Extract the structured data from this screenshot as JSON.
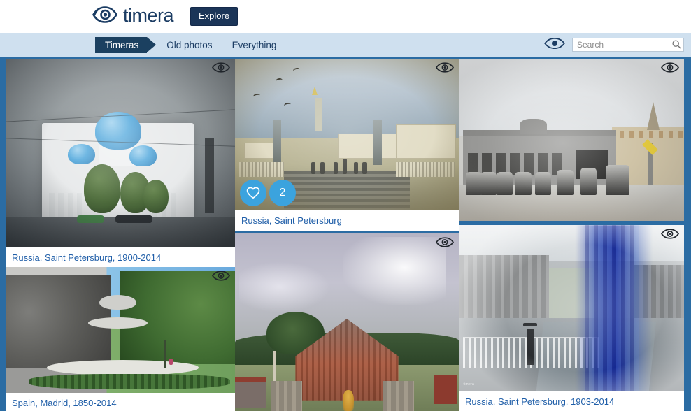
{
  "site": {
    "brand_name": "timera",
    "logo_icon": "eye-logo-icon",
    "explore_label": "Explore"
  },
  "nav": {
    "tabs": [
      {
        "label": "Timeras",
        "active": true
      },
      {
        "label": "Old photos",
        "active": false
      },
      {
        "label": "Everything",
        "active": false
      }
    ],
    "eye_icon": "eye-icon",
    "search": {
      "placeholder": "Search",
      "value": "",
      "icon": "search-icon"
    }
  },
  "colors": {
    "page_background": "#2b6ca3",
    "navbar_background": "#cfe0ef",
    "accent_dark": "#1b3558",
    "tab_active": "#1b4060",
    "caption_text": "#1f5ea8",
    "badge_blue": "#3ba3de"
  },
  "grid": {
    "cards": [
      {
        "id": "card-trinity-cathedral",
        "caption": "Russia, Saint Petersburg, 1900-2014",
        "has_caption": true,
        "overlay_icon": "eye-icon",
        "likes": null,
        "comments": null
      },
      {
        "id": "card-canal-bridge",
        "caption": "Russia, Saint Petersburg",
        "has_caption": true,
        "overlay_icon": "eye-icon",
        "likes": "heart-icon",
        "comments": "2"
      },
      {
        "id": "card-vintage-cars",
        "caption": "",
        "has_caption": false,
        "overlay_icon": "eye-icon",
        "likes": null,
        "comments": null
      },
      {
        "id": "card-madrid-fountain",
        "caption": "Spain, Madrid, 1850-2014",
        "has_caption": true,
        "overlay_icon": "eye-icon",
        "likes": null,
        "comments": null
      },
      {
        "id": "card-barn-farm",
        "caption": "",
        "has_caption": false,
        "overlay_icon": "eye-icon",
        "likes": null,
        "comments": null
      },
      {
        "id": "card-canal-embankment",
        "caption": "Russia, Saint Petersburg, 1903-2014",
        "has_caption": true,
        "overlay_icon": "eye-icon",
        "likes": null,
        "comments": null,
        "watermark": "timera"
      }
    ]
  }
}
